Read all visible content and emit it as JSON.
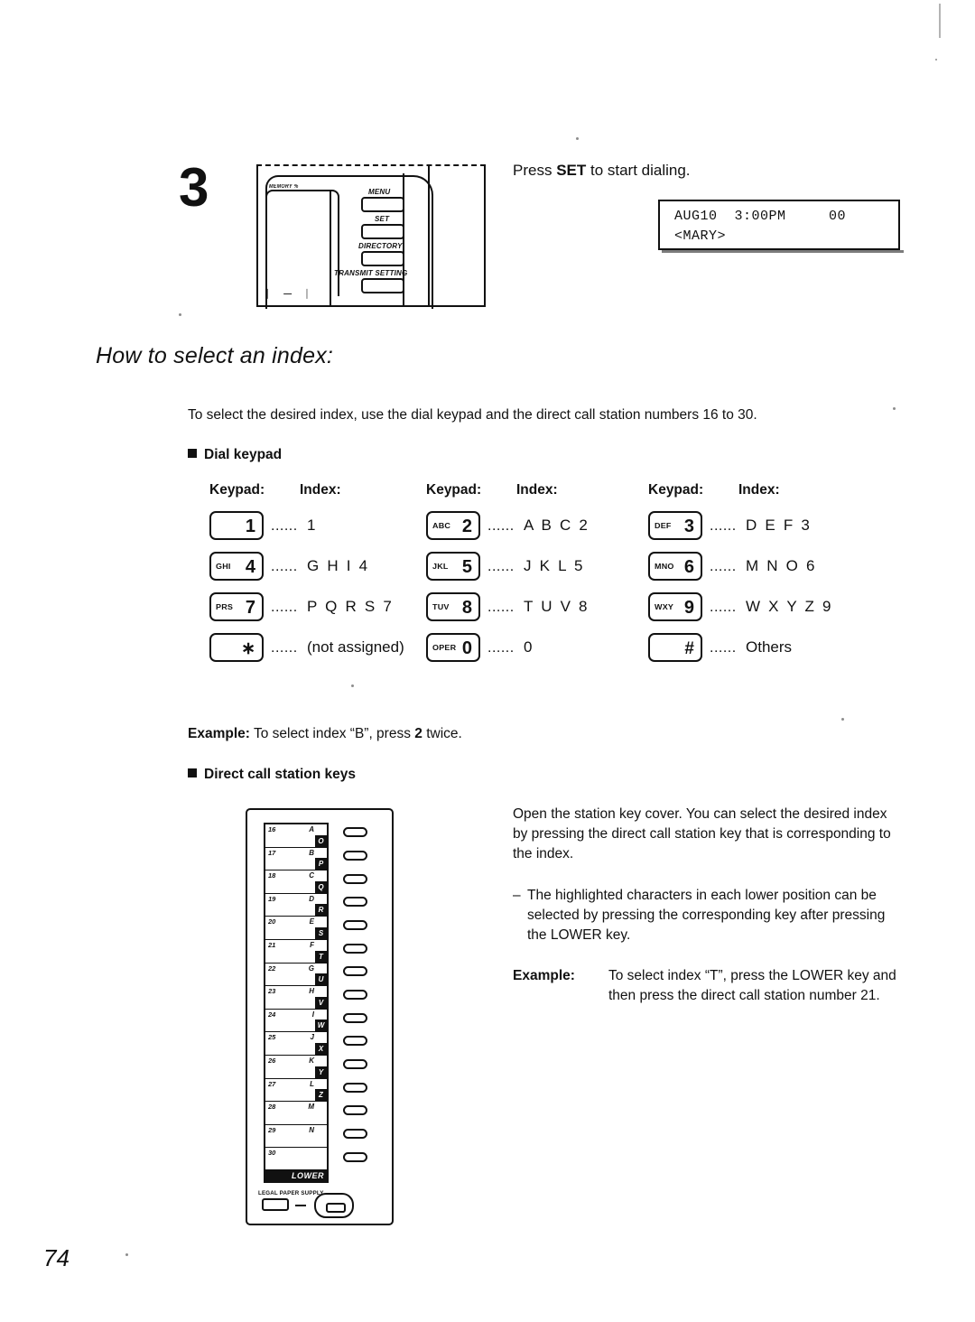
{
  "page": {
    "number": "74"
  },
  "step": {
    "number": "3",
    "instruction_prefix": "Press ",
    "instruction_key": "SET",
    "instruction_suffix": " to start dialing.",
    "lcd_line_1": "AUG10  3:00PM     00",
    "lcd_line_2": "<MARY>"
  },
  "machine_illustration": {
    "memory_label": "MEMORY %",
    "buttons": [
      {
        "label": "MENU"
      },
      {
        "label": "SET"
      },
      {
        "label": "DIRECTORY"
      },
      {
        "label": "TRANSMIT SETTING"
      }
    ]
  },
  "section": {
    "heading": "How to select an index:",
    "intro": "To select the desired index, use the dial keypad and the direct call station numbers 16 to 30."
  },
  "dial_keypad": {
    "heading": "Dial keypad",
    "columns": [
      {
        "head_keypad": "Keypad:",
        "head_index": "Index:",
        "rows": [
          {
            "letters": "",
            "digit": "1",
            "dots": "......",
            "index": "1",
            "index_plain": true
          },
          {
            "letters": "GHI",
            "digit": "4",
            "dots": "......",
            "index": "G H I 4"
          },
          {
            "letters": "PRS",
            "digit": "7",
            "dots": "......",
            "index": "P Q R S 7"
          },
          {
            "letters": "",
            "digit": "∗",
            "dots": "......",
            "index": "(not assigned)",
            "index_plain": true
          }
        ]
      },
      {
        "head_keypad": "Keypad:",
        "head_index": "Index:",
        "rows": [
          {
            "letters": "ABC",
            "digit": "2",
            "dots": "......",
            "index": "A B C 2"
          },
          {
            "letters": "JKL",
            "digit": "5",
            "dots": "......",
            "index": "J K L 5"
          },
          {
            "letters": "TUV",
            "digit": "8",
            "dots": "......",
            "index": "T U V 8"
          },
          {
            "letters": "OPER",
            "digit": "0",
            "dots": "......",
            "index": "0",
            "index_plain": true
          }
        ]
      },
      {
        "head_keypad": "Keypad:",
        "head_index": "Index:",
        "rows": [
          {
            "letters": "DEF",
            "digit": "3",
            "dots": "......",
            "index": "D E F 3"
          },
          {
            "letters": "MNO",
            "digit": "6",
            "dots": "......",
            "index": "M N O 6"
          },
          {
            "letters": "WXY",
            "digit": "9",
            "dots": "......",
            "index": "W X Y Z 9"
          },
          {
            "letters": "",
            "digit": "#",
            "dots": "......",
            "index": "Others",
            "index_plain": true
          }
        ]
      }
    ],
    "example_label": "Example:",
    "example_text_a": " To select index “B”, press ",
    "example_text_b": "2",
    "example_text_c": " twice."
  },
  "direct_call": {
    "heading": "Direct call station keys",
    "paragraph_1": "Open the station key cover. You can select the desired index by pressing the direct call station key that is corresponding to the index.",
    "dash": "–",
    "paragraph_2": "The highlighted characters in each lower position can be selected by pressing the corresponding key after pressing the LOWER key.",
    "example_label": "Example:",
    "example_text": "To select index “T”, press the LOWER key and then press the direct call station number 21."
  },
  "station_diagram": {
    "rows": [
      {
        "number": "16",
        "upper": "A",
        "lower": "O"
      },
      {
        "number": "17",
        "upper": "B",
        "lower": "P"
      },
      {
        "number": "18",
        "upper": "C",
        "lower": "Q"
      },
      {
        "number": "19",
        "upper": "D",
        "lower": "R"
      },
      {
        "number": "20",
        "upper": "E",
        "lower": "S"
      },
      {
        "number": "21",
        "upper": "F",
        "lower": "T"
      },
      {
        "number": "22",
        "upper": "G",
        "lower": "U"
      },
      {
        "number": "23",
        "upper": "H",
        "lower": "V"
      },
      {
        "number": "24",
        "upper": "I",
        "lower": "W"
      },
      {
        "number": "25",
        "upper": "J",
        "lower": "X"
      },
      {
        "number": "26",
        "upper": "K",
        "lower": "Y"
      },
      {
        "number": "27",
        "upper": "L",
        "lower": "Z"
      },
      {
        "number": "28",
        "upper": "M",
        "lower": ""
      },
      {
        "number": "29",
        "upper": "N",
        "lower": ""
      },
      {
        "number": "30",
        "upper": "",
        "lower": ""
      }
    ],
    "lower_key_label": "LOWER",
    "legal_paper_label": "LEGAL PAPER SUPPLY"
  },
  "colors": {
    "ink": "#111111",
    "paper": "#ffffff"
  }
}
